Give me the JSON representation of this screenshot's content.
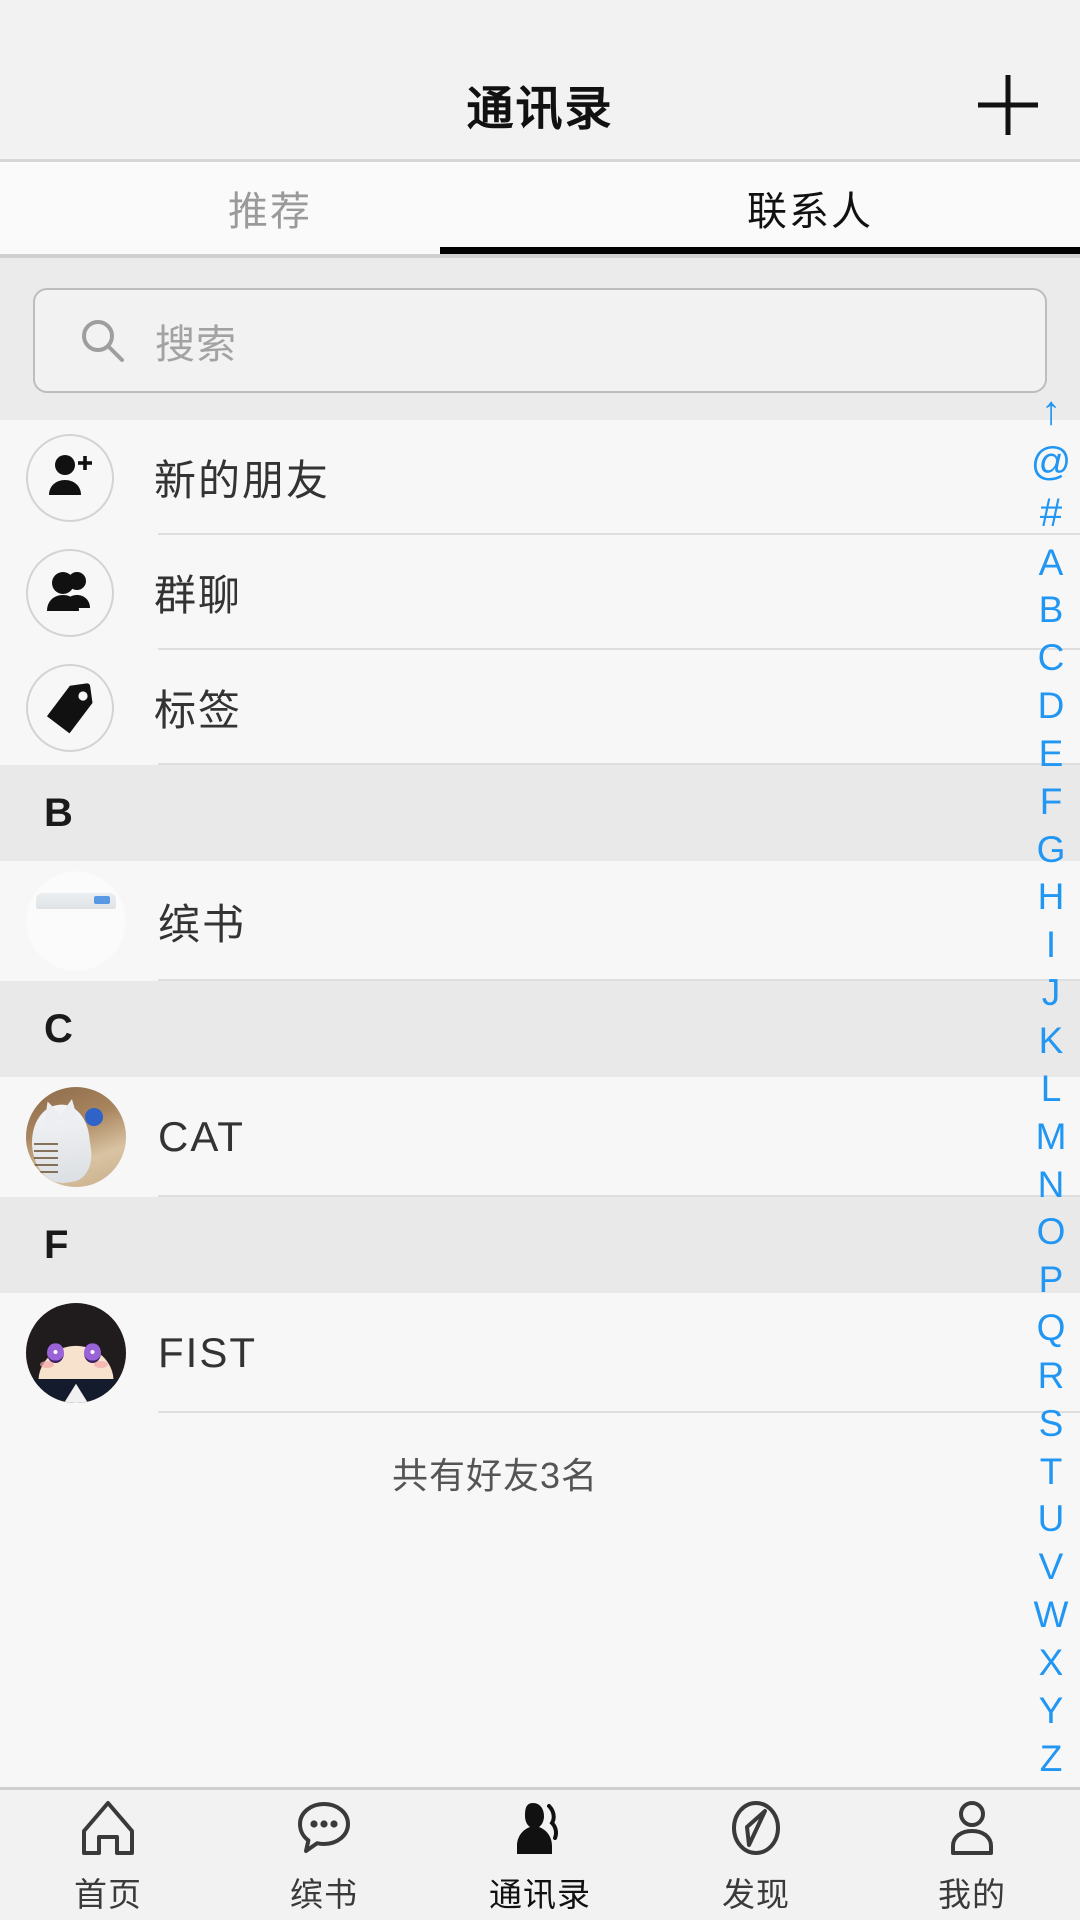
{
  "header": {
    "title": "通讯录",
    "add_icon": "plus-icon"
  },
  "tabs": [
    {
      "label": "推荐",
      "active": false
    },
    {
      "label": "联系人",
      "active": true
    }
  ],
  "search": {
    "placeholder": "搜索",
    "value": "",
    "icon": "search-icon"
  },
  "entries": [
    {
      "label": "新的朋友",
      "icon": "person-add-icon"
    },
    {
      "label": "群聊",
      "icon": "group-people-icon"
    },
    {
      "label": "标签",
      "icon": "tag-icon"
    }
  ],
  "sections": [
    {
      "letter": "B",
      "contacts": [
        {
          "name": "缤书",
          "avatar": "book-thumbnail-avatar"
        }
      ]
    },
    {
      "letter": "C",
      "contacts": [
        {
          "name": "CAT",
          "avatar": "cat-photo-avatar"
        }
      ]
    },
    {
      "letter": "F",
      "contacts": [
        {
          "name": "FIST",
          "avatar": "anime-girl-avatar"
        }
      ]
    }
  ],
  "list_footer": "共有好友3名",
  "alpha_index": {
    "color": "#2196f3",
    "items": [
      "↑",
      "@",
      "#",
      "A",
      "B",
      "C",
      "D",
      "E",
      "F",
      "G",
      "H",
      "I",
      "J",
      "K",
      "L",
      "M",
      "N",
      "O",
      "P",
      "Q",
      "R",
      "S",
      "T",
      "U",
      "V",
      "W",
      "X",
      "Y",
      "Z"
    ]
  },
  "bottom_nav": [
    {
      "label": "首页",
      "icon": "home-icon",
      "active": false
    },
    {
      "label": "缤书",
      "icon": "chat-bubble-icon",
      "active": false
    },
    {
      "label": "通讯录",
      "icon": "contacts-icon",
      "active": true
    },
    {
      "label": "发现",
      "icon": "compass-icon",
      "active": false
    },
    {
      "label": "我的",
      "icon": "person-icon",
      "active": false
    }
  ]
}
